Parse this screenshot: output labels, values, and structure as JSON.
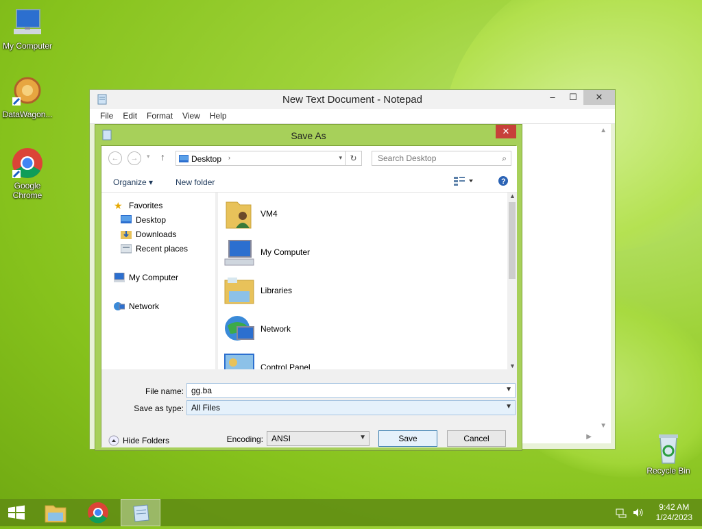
{
  "desktop": {
    "icons": [
      {
        "label": "My Computer",
        "icon": "computer-icon"
      },
      {
        "label": "DataWagon...",
        "icon": "datawagon-icon"
      },
      {
        "label": "Google Chrome",
        "icon": "chrome-icon"
      },
      {
        "label": "Recycle Bin",
        "icon": "recycle-bin-icon"
      }
    ]
  },
  "notepad": {
    "title": "New Text Document - Notepad",
    "menu": [
      "File",
      "Edit",
      "Format",
      "View",
      "Help"
    ],
    "controls": {
      "minimize": "–",
      "maximize": "☐",
      "close": "✕"
    }
  },
  "save_dialog": {
    "title": "Save As",
    "close": "✕",
    "address": "Desktop",
    "search_placeholder": "Search Desktop",
    "organize": "Organize ▾",
    "new_folder": "New folder",
    "nav_pane": {
      "favorites": "Favorites",
      "favorites_items": [
        "Desktop",
        "Downloads",
        "Recent places"
      ],
      "my_computer": "My Computer",
      "network": "Network"
    },
    "items": [
      "VM4",
      "My Computer",
      "Libraries",
      "Network",
      "Control Panel"
    ],
    "file_name_label": "File name:",
    "file_name_value": "gg.ba",
    "save_type_label": "Save as type:",
    "save_type_value": "All Files",
    "hide_folders": "Hide Folders",
    "encoding_label": "Encoding:",
    "encoding_value": "ANSI",
    "save_button": "Save",
    "cancel_button": "Cancel"
  },
  "taskbar": {
    "time": "9:42 AM",
    "date": "1/24/2023"
  },
  "colors": {
    "accent": "#a7d05a",
    "close_red": "#c7403a",
    "taskbar": "#608c14"
  }
}
